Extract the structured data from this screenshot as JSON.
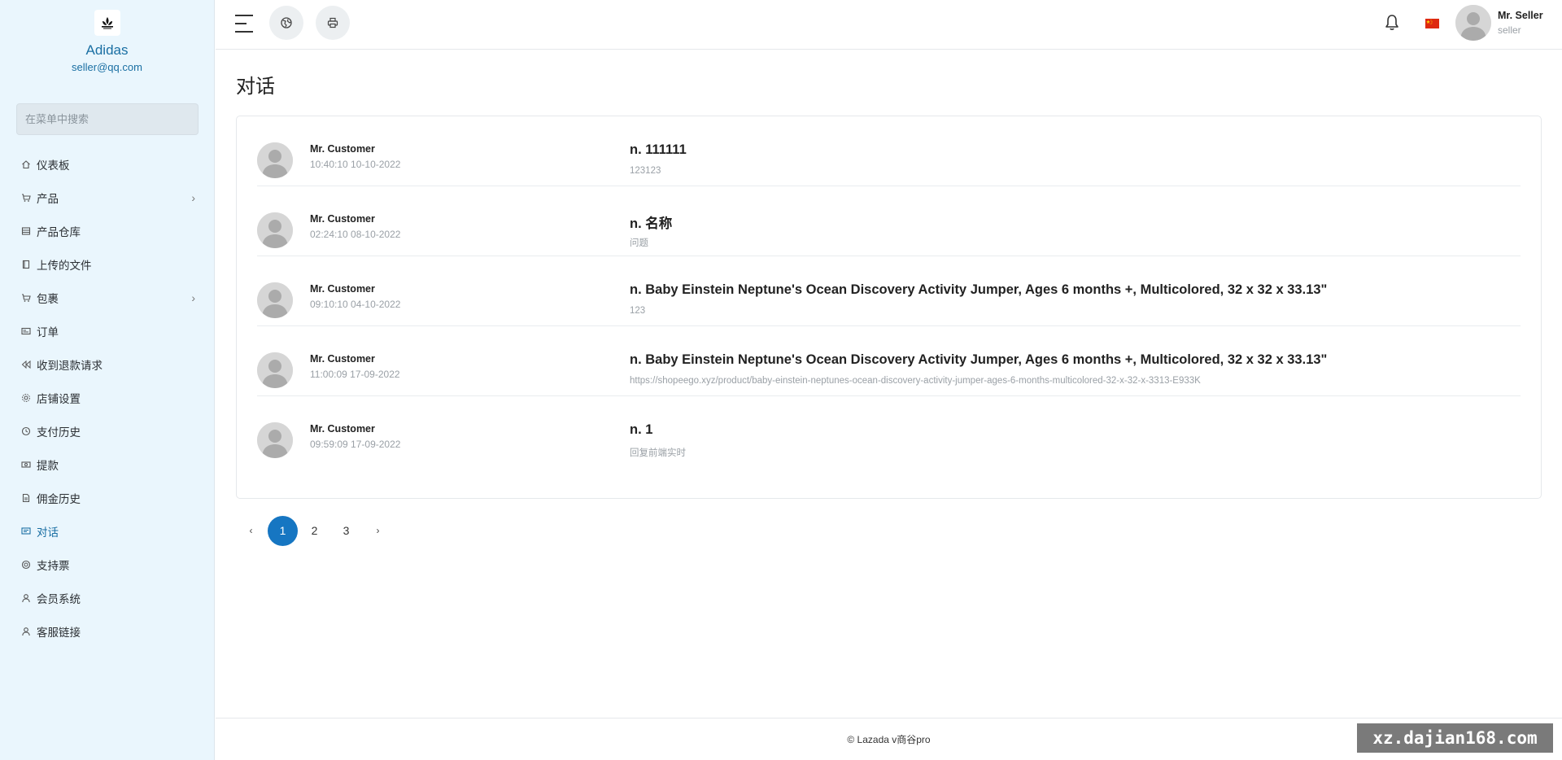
{
  "sidebar": {
    "brand_name": "Adidas",
    "brand_email": "seller@qq.com",
    "search_placeholder": "在菜单中搜索",
    "items": [
      {
        "label": "仪表板",
        "icon": "home-icon",
        "arrow": false,
        "active": false
      },
      {
        "label": "产品",
        "icon": "cart-icon",
        "arrow": true,
        "active": false
      },
      {
        "label": "产品仓库",
        "icon": "storage-icon",
        "arrow": false,
        "active": false
      },
      {
        "label": "上传的文件",
        "icon": "folder-icon",
        "arrow": false,
        "active": false
      },
      {
        "label": "包裹",
        "icon": "cart-icon",
        "arrow": true,
        "active": false
      },
      {
        "label": "订单",
        "icon": "card-icon",
        "arrow": false,
        "active": false
      },
      {
        "label": "收到退款请求",
        "icon": "backward-icon",
        "arrow": false,
        "active": false
      },
      {
        "label": "店铺设置",
        "icon": "gear-icon",
        "arrow": false,
        "active": false
      },
      {
        "label": "支付历史",
        "icon": "history-icon",
        "arrow": false,
        "active": false
      },
      {
        "label": "提款",
        "icon": "money-icon",
        "arrow": false,
        "active": false
      },
      {
        "label": "佣金历史",
        "icon": "document-icon",
        "arrow": false,
        "active": false
      },
      {
        "label": "对话",
        "icon": "chat-icon",
        "arrow": false,
        "active": true
      },
      {
        "label": "支持票",
        "icon": "support-icon",
        "arrow": false,
        "active": false
      },
      {
        "label": "会员系统",
        "icon": "user-icon",
        "arrow": false,
        "active": false
      },
      {
        "label": "客服链接",
        "icon": "user-icon",
        "arrow": false,
        "active": false
      }
    ]
  },
  "header": {
    "user_name": "Mr. Seller",
    "user_role": "seller",
    "language_flag": "cn-flag-icon"
  },
  "main": {
    "title": "对话",
    "conversations": [
      {
        "name": "Mr. Customer",
        "time": "10:40:10 10-10-2022",
        "subject": "n. 111111",
        "preview": "123123"
      },
      {
        "name": "Mr. Customer",
        "time": "02:24:10 08-10-2022",
        "subject": "n. 名称",
        "preview": "问题"
      },
      {
        "name": "Mr. Customer",
        "time": "09:10:10 04-10-2022",
        "subject": "n. Baby Einstein Neptune's Ocean Discovery Activity Jumper, Ages 6 months +, Multicolored, 32 x 32 x 33.13\"",
        "preview": "123"
      },
      {
        "name": "Mr. Customer",
        "time": "11:00:09 17-09-2022",
        "subject": "n. Baby Einstein Neptune's Ocean Discovery Activity Jumper, Ages 6 months +, Multicolored, 32 x 32 x 33.13\"",
        "preview": "https://shopeego.xyz/product/baby-einstein-neptunes-ocean-discovery-activity-jumper-ages-6-months-multicolored-32-x-32-x-3313-E933K"
      },
      {
        "name": "Mr. Customer",
        "time": "09:59:09 17-09-2022",
        "subject": "n. 1",
        "preview": "回复前端实时"
      }
    ],
    "pagination": {
      "prev": "‹",
      "pages": [
        "1",
        "2",
        "3"
      ],
      "current": "1",
      "next": "›"
    }
  },
  "footer": {
    "text": "© Lazada v商谷pro"
  },
  "watermark": {
    "text": "xz.dajian168.com"
  },
  "colors": {
    "accent": "#1676c2",
    "sidebar_bg": "#eaf6fd",
    "brand": "#1a6fa3",
    "flag_red": "#de2910"
  }
}
